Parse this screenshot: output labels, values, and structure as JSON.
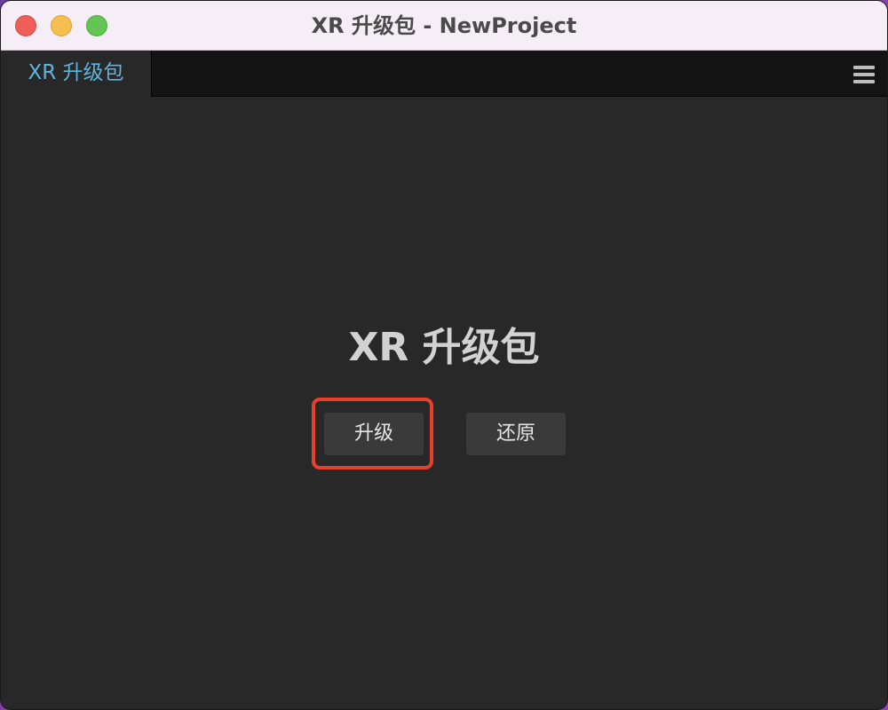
{
  "window": {
    "title": "XR 升级包 - NewProject"
  },
  "tabs": [
    {
      "label": "XR 升级包"
    }
  ],
  "main": {
    "heading": "XR 升级包",
    "buttons": {
      "upgrade": "升级",
      "restore": "还原"
    }
  },
  "colors": {
    "tab_text": "#5fb4dc",
    "highlight": "#e8402a",
    "panel_bg": "#282828"
  },
  "icons": {
    "menu": "hamburger-menu-icon"
  }
}
